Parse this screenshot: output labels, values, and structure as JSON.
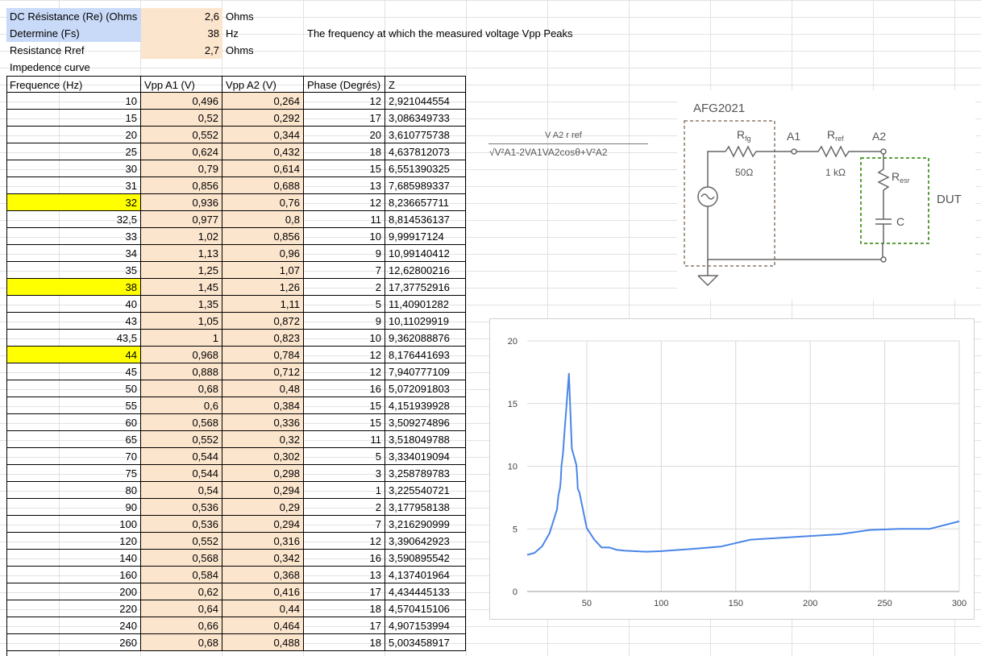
{
  "params": [
    {
      "label": "DC Résistance (Re) (Ohms",
      "value": "2,6",
      "unit": "Ohms",
      "note": ""
    },
    {
      "label": "Determine (Fs)",
      "value": "38",
      "unit": "Hz",
      "note": "The frequency at which the measured voltage Vpp Peaks"
    },
    {
      "label": "Resistance Rref",
      "value": "2,7",
      "unit": "Ohms",
      "note": ""
    }
  ],
  "section_title": "Impedence curve",
  "headers": [
    "Frequence (Hz)",
    "Vpp A1 (V)",
    "Vpp A2 (V)",
    "Phase (Degrés)",
    "Z"
  ],
  "rows": [
    [
      "10",
      "0,496",
      "0,264",
      "12",
      "2,921044554"
    ],
    [
      "15",
      "0,52",
      "0,292",
      "17",
      "3,086349733"
    ],
    [
      "20",
      "0,552",
      "0,344",
      "20",
      "3,610775738"
    ],
    [
      "25",
      "0,624",
      "0,432",
      "18",
      "4,637812073"
    ],
    [
      "30",
      "0,79",
      "0,614",
      "15",
      "6,551390325"
    ],
    [
      "31",
      "0,856",
      "0,688",
      "13",
      "7,685989337"
    ],
    [
      "32",
      "0,936",
      "0,76",
      "12",
      "8,236657711"
    ],
    [
      "32,5",
      "0,977",
      "0,8",
      "11",
      "8,814536137"
    ],
    [
      "33",
      "1,02",
      "0,856",
      "10",
      "9,99917124"
    ],
    [
      "34",
      "1,13",
      "0,96",
      "9",
      "10,99140412"
    ],
    [
      "35",
      "1,25",
      "1,07",
      "7",
      "12,62800216"
    ],
    [
      "38",
      "1,45",
      "1,26",
      "2",
      "17,37752916"
    ],
    [
      "40",
      "1,35",
      "1,11",
      "5",
      "11,40901282"
    ],
    [
      "43",
      "1,05",
      "0,872",
      "9",
      "10,11029919"
    ],
    [
      "43,5",
      "1",
      "0,823",
      "10",
      "9,362088876"
    ],
    [
      "44",
      "0,968",
      "0,784",
      "12",
      "8,176441693"
    ],
    [
      "45",
      "0,888",
      "0,712",
      "12",
      "7,940777109"
    ],
    [
      "50",
      "0,68",
      "0,48",
      "16",
      "5,072091803"
    ],
    [
      "55",
      "0,6",
      "0,384",
      "15",
      "4,151939928"
    ],
    [
      "60",
      "0,568",
      "0,336",
      "15",
      "3,509274896"
    ],
    [
      "65",
      "0,552",
      "0,32",
      "11",
      "3,518049788"
    ],
    [
      "70",
      "0,544",
      "0,302",
      "5",
      "3,334019094"
    ],
    [
      "75",
      "0,544",
      "0,298",
      "3",
      "3,258789783"
    ],
    [
      "80",
      "0,54",
      "0,294",
      "1",
      "3,225540721"
    ],
    [
      "90",
      "0,536",
      "0,29",
      "2",
      "3,177958138"
    ],
    [
      "100",
      "0,536",
      "0,294",
      "7",
      "3,216290999"
    ],
    [
      "120",
      "0,552",
      "0,316",
      "12",
      "3,390642923"
    ],
    [
      "140",
      "0,568",
      "0,342",
      "16",
      "3,590895542"
    ],
    [
      "160",
      "0,584",
      "0,368",
      "13",
      "4,137401964"
    ],
    [
      "200",
      "0,62",
      "0,416",
      "17",
      "4,434445133"
    ],
    [
      "220",
      "0,64",
      "0,44",
      "18",
      "4,570415106"
    ],
    [
      "240",
      "0,66",
      "0,464",
      "17",
      "4,907153994"
    ],
    [
      "260",
      "0,68",
      "0,488",
      "18",
      "5,003458917"
    ]
  ],
  "highlighted_rows": [
    6,
    11,
    15
  ],
  "formula": {
    "numerator": "V A2 r ref",
    "denominator": "√V²A1-2VA1VA2cosθ+V²A2"
  },
  "circuit": {
    "device": "AFG2021",
    "r_fg": "R",
    "r_fg_sub": "fg",
    "r_fg_value": "50Ω",
    "node_a1": "A1",
    "r_ref": "R",
    "r_ref_sub": "ref",
    "r_ref_value": "1 kΩ",
    "node_a2": "A2",
    "r_esr": "R",
    "r_esr_sub": "esr",
    "cap": "C",
    "dut": "DUT"
  },
  "colors": {
    "accent_blue": "#c9daf8",
    "input_tan": "#fce5cd",
    "highlight": "#ffff00",
    "line": "#4a86e8",
    "grid": "#d9d9d9"
  },
  "chart_data": {
    "type": "line",
    "title": "",
    "xlabel": "",
    "ylabel": "",
    "xlim": [
      10,
      300
    ],
    "ylim": [
      0,
      20
    ],
    "x_ticks": [
      50,
      100,
      150,
      200,
      250,
      300
    ],
    "y_ticks": [
      0,
      5,
      10,
      15,
      20
    ],
    "grid": true,
    "series": [
      {
        "x": [
          10,
          15,
          20,
          25,
          30,
          31,
          32,
          32.5,
          33,
          34,
          35,
          38,
          40,
          43,
          43.5,
          44,
          45,
          50,
          55,
          60,
          65,
          70,
          75,
          80,
          90,
          100,
          120,
          140,
          160,
          200,
          220,
          240,
          260,
          280,
          300
        ],
        "y": [
          2.92,
          3.09,
          3.61,
          4.64,
          6.55,
          7.69,
          8.24,
          8.81,
          10.0,
          10.99,
          12.63,
          17.38,
          11.41,
          10.11,
          9.36,
          8.18,
          7.94,
          5.07,
          4.15,
          3.51,
          3.52,
          3.33,
          3.26,
          3.23,
          3.18,
          3.22,
          3.39,
          3.59,
          4.14,
          4.43,
          4.57,
          4.91,
          5.0,
          5.0,
          5.6
        ]
      }
    ]
  }
}
